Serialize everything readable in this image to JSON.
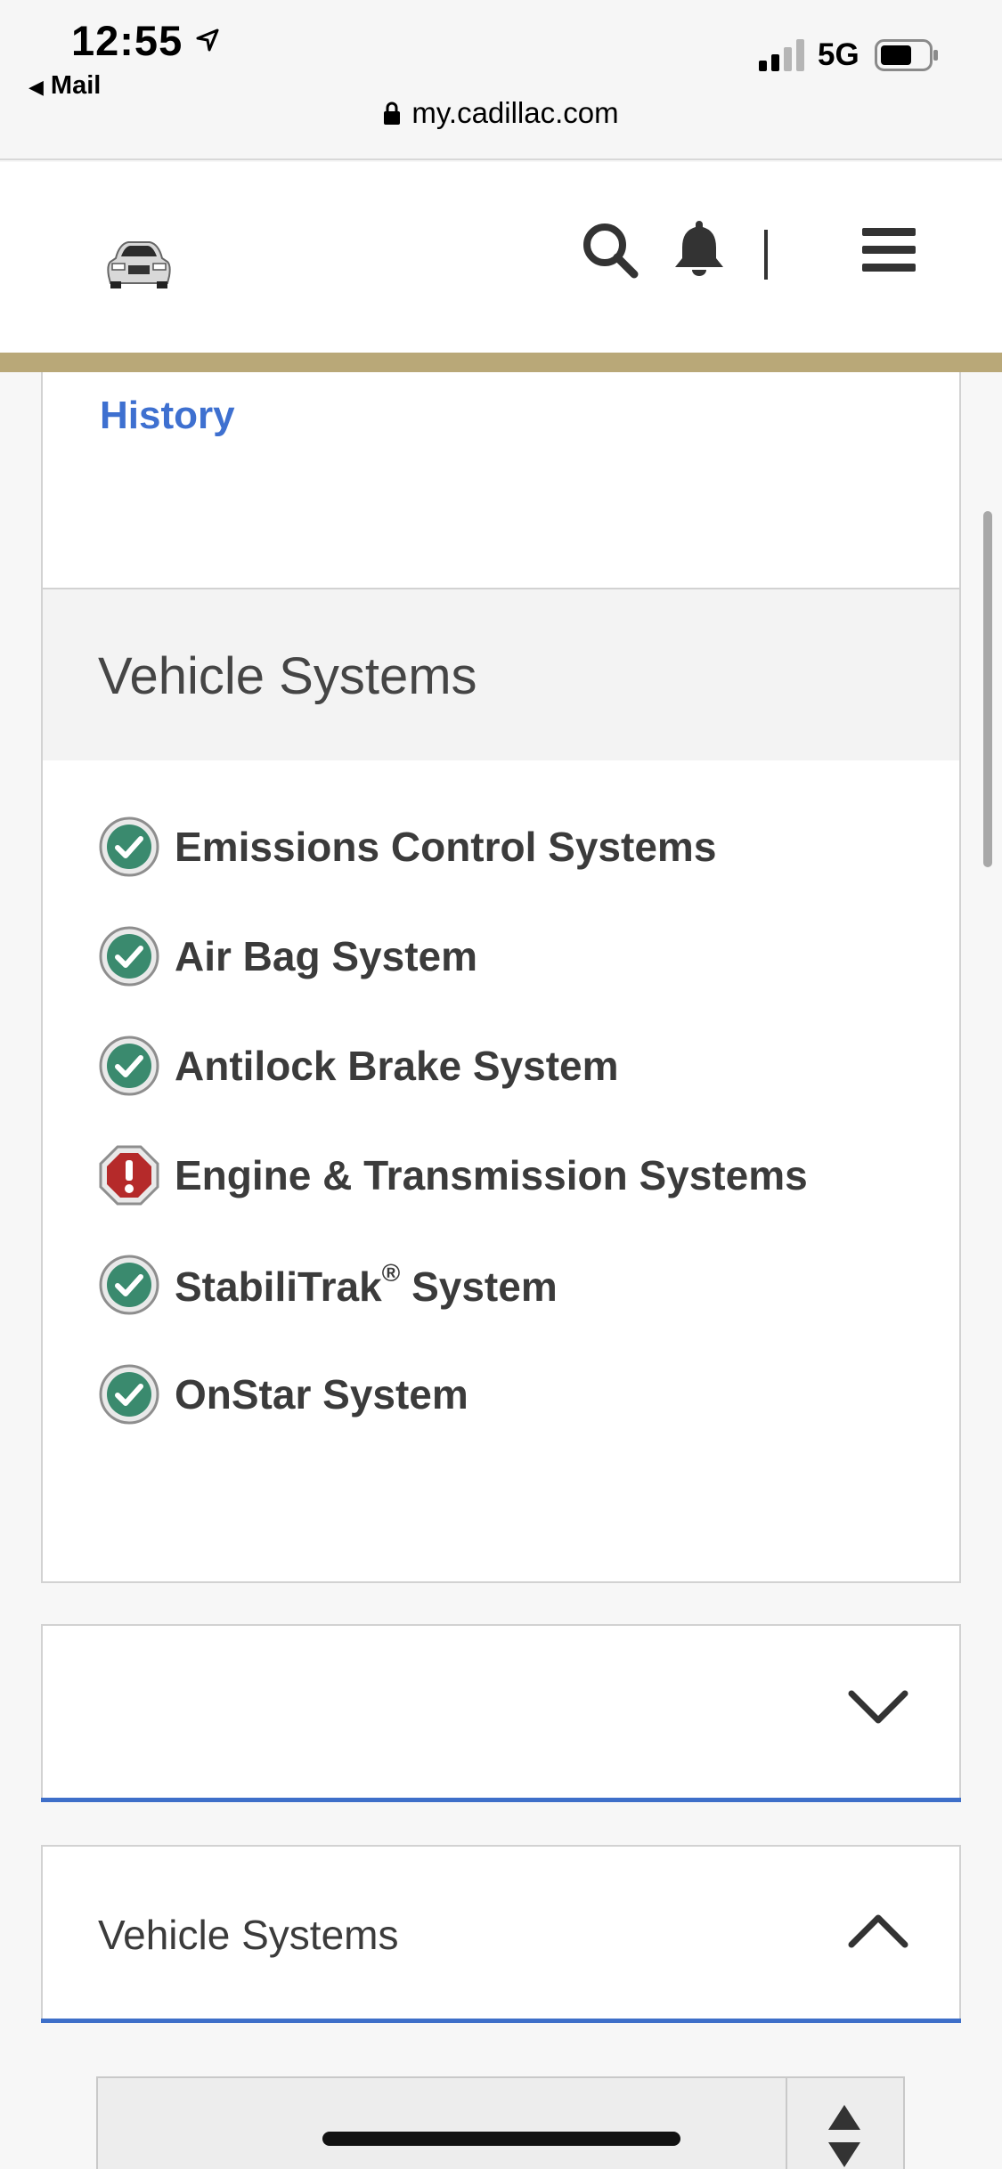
{
  "status_bar": {
    "time": "12:55",
    "back_app": "Mail",
    "network": "5G"
  },
  "browser": {
    "url": "my.cadillac.com"
  },
  "header": {
    "logo_icon": "car-icon",
    "search_icon": "search-icon",
    "notification_icon": "bell-icon",
    "menu_icon": "hamburger-menu-icon"
  },
  "history": {
    "link_label": "History"
  },
  "vehicle_systems": {
    "title": "Vehicle Systems",
    "items": [
      {
        "label": "Emissions Control Systems",
        "status": "ok"
      },
      {
        "label": "Air Bag System",
        "status": "ok"
      },
      {
        "label": "Antilock Brake System",
        "status": "ok"
      },
      {
        "label": "Engine & Transmission Systems",
        "status": "alert"
      },
      {
        "label": "StabiliTrak",
        "label_sup": "®",
        "label_suffix": " System",
        "status": "ok"
      },
      {
        "label": "OnStar System",
        "status": "ok"
      }
    ]
  },
  "accordion": {
    "collapsed_label": "",
    "expanded_label": "Vehicle Systems"
  },
  "colors": {
    "accent_gold": "#b9a878",
    "link_blue": "#3e70d0",
    "ok_green": "#3a8a6e",
    "alert_red": "#b52a2a"
  }
}
